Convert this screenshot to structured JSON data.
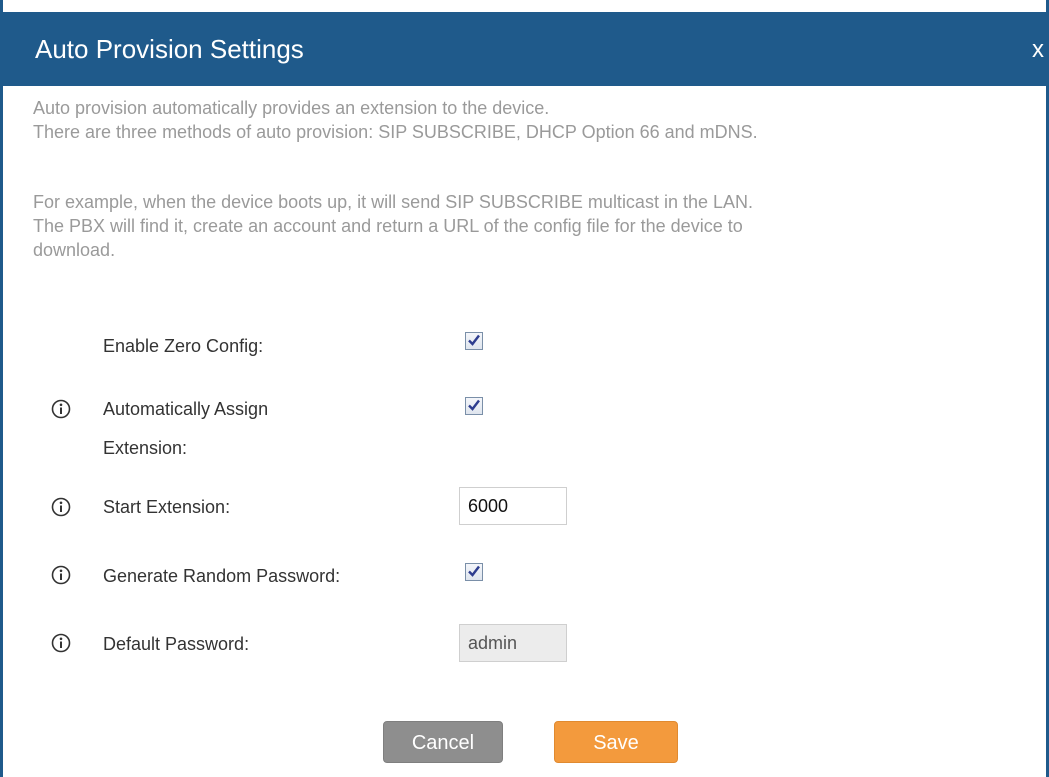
{
  "dialog": {
    "title": "Auto Provision Settings",
    "close_label": "x"
  },
  "description": {
    "line1": "Auto provision automatically provides an extension to the device.",
    "line2": "There are three methods of auto provision: SIP SUBSCRIBE, DHCP Option 66 and mDNS.",
    "line3": "For example, when the device boots up, it will send SIP SUBSCRIBE multicast in the LAN.",
    "line4": "The PBX will find it, create an account and return a URL of the config file for the device to",
    "line5": "download."
  },
  "fields": {
    "enable_zero_config": {
      "label": "Enable Zero Config:",
      "checked": true
    },
    "auto_assign": {
      "label_line1": "Automatically Assign",
      "label_line2": "Extension:",
      "checked": true
    },
    "start_extension": {
      "label": "Start Extension:",
      "value": "6000"
    },
    "random_password": {
      "label": "Generate Random Password:",
      "checked": true
    },
    "default_password": {
      "label": "Default Password:",
      "value": "admin"
    }
  },
  "buttons": {
    "cancel": "Cancel",
    "save": "Save"
  },
  "colors": {
    "header": "#1f5a8b",
    "save": "#f39a3d",
    "cancel": "#8e8e8e"
  },
  "icons": {
    "info": "info-icon",
    "check": "checkmark-icon"
  }
}
